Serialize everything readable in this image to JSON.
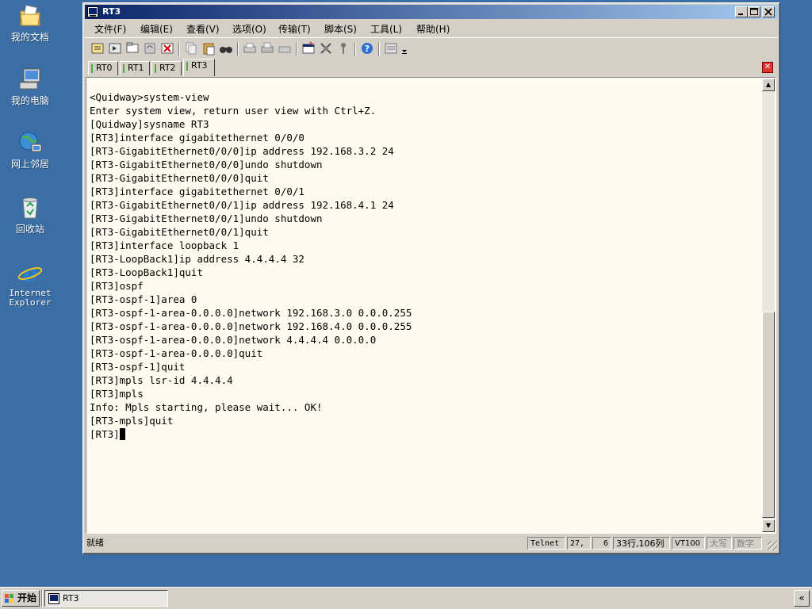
{
  "desktop": {
    "icons": [
      {
        "label": "我的文档",
        "icon": "my-documents-icon"
      },
      {
        "label": "我的电脑",
        "icon": "my-computer-icon"
      },
      {
        "label": "网上邻居",
        "icon": "network-places-icon"
      },
      {
        "label": "回收站",
        "icon": "recycle-bin-icon"
      },
      {
        "label": "Internet\nExplorer",
        "icon": "internet-explorer-icon"
      }
    ]
  },
  "window": {
    "title": "RT3",
    "menu": [
      "文件(F)",
      "编辑(E)",
      "查看(V)",
      "选项(O)",
      "传输(T)",
      "脚本(S)",
      "工具(L)",
      "帮助(H)"
    ],
    "tabs": [
      "RT0",
      "RT1",
      "RT2",
      "RT3"
    ],
    "active_tab": "RT3",
    "terminal_lines": [
      "<Quidway>system-view",
      "Enter system view, return user view with Ctrl+Z.",
      "[Quidway]sysname RT3",
      "[RT3]interface gigabitethernet 0/0/0",
      "[RT3-GigabitEthernet0/0/0]ip address 192.168.3.2 24",
      "[RT3-GigabitEthernet0/0/0]undo shutdown",
      "[RT3-GigabitEthernet0/0/0]quit",
      "[RT3]interface gigabitethernet 0/0/1",
      "[RT3-GigabitEthernet0/0/1]ip address 192.168.4.1 24",
      "[RT3-GigabitEthernet0/0/1]undo shutdown",
      "[RT3-GigabitEthernet0/0/1]quit",
      "[RT3]interface loopback 1",
      "[RT3-LoopBack1]ip address 4.4.4.4 32",
      "[RT3-LoopBack1]quit",
      "[RT3]ospf",
      "[RT3-ospf-1]area 0",
      "[RT3-ospf-1-area-0.0.0.0]network 192.168.3.0 0.0.0.255",
      "[RT3-ospf-1-area-0.0.0.0]network 192.168.4.0 0.0.0.255",
      "[RT3-ospf-1-area-0.0.0.0]network 4.4.4.4 0.0.0.0",
      "[RT3-ospf-1-area-0.0.0.0]quit",
      "[RT3-ospf-1]quit",
      "[RT3]mpls lsr-id 4.4.4.4",
      "[RT3]mpls",
      "Info: Mpls starting, please wait... OK!",
      "[RT3-mpls]quit"
    ],
    "prompt": "[RT3]",
    "status": {
      "ready": "就绪",
      "protocol": "Telnet",
      "row": "27,",
      "col": "6",
      "size": "33行,106列",
      "term": "VT100",
      "caps": "大写",
      "num": "数字"
    }
  },
  "taskbar": {
    "start_label": "开始",
    "task_label": "RT3",
    "tray_label": "«"
  },
  "colors": {
    "desktop": "#3a6ea5",
    "titlebar": "#0a246a",
    "terminal_bg": "#fffbf0"
  }
}
